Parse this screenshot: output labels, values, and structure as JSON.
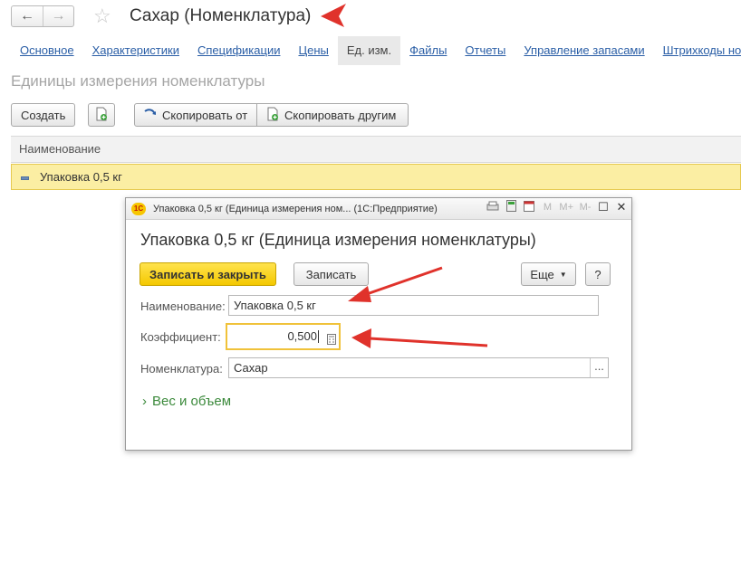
{
  "header": {
    "back_icon": "←",
    "forward_icon": "→",
    "star_icon": "☆",
    "title": "Сахар (Номенклатура)"
  },
  "tabs": [
    {
      "label": "Основное",
      "active": false
    },
    {
      "label": "Характеристики",
      "active": false
    },
    {
      "label": "Спецификации",
      "active": false
    },
    {
      "label": "Цены",
      "active": false
    },
    {
      "label": "Ед. изм.",
      "active": true
    },
    {
      "label": "Файлы",
      "active": false
    },
    {
      "label": "Отчеты",
      "active": false
    },
    {
      "label": "Управление запасами",
      "active": false
    },
    {
      "label": "Штрихкоды номе",
      "active": false
    }
  ],
  "section": {
    "title": "Единицы измерения номенклатуры"
  },
  "toolbar": {
    "create_label": "Создать",
    "copy_from_label": "Скопировать от",
    "copy_to_others_label": "Скопировать другим"
  },
  "list": {
    "column_header": "Наименование",
    "rows": [
      "Упаковка 0,5 кг"
    ]
  },
  "dialog": {
    "app_logo": "1С",
    "window_title": "Упаковка 0,5 кг (Единица измерения ном...  (1С:Предприятие)",
    "tool_m": "M",
    "tool_mplus": "M+",
    "tool_mminus": "M-",
    "heading": "Упаковка 0,5 кг (Единица измерения номенклатуры)",
    "save_close_label": "Записать и закрыть",
    "save_label": "Записать",
    "more_label": "Еще",
    "help_label": "?",
    "name_label": "Наименование:",
    "name_value": "Упаковка 0,5 кг",
    "coef_label": "Коэффициент:",
    "coef_value": "0,500",
    "nomen_label": "Номенклатура:",
    "nomen_value": "Сахар",
    "select_button": "...",
    "group_label": "Вес и объем"
  },
  "colors": {
    "accent_yellow": "#f4c800",
    "link_blue": "#2a5ea6",
    "arrow_red": "#e0322b",
    "group_green": "#3c8a3c"
  }
}
